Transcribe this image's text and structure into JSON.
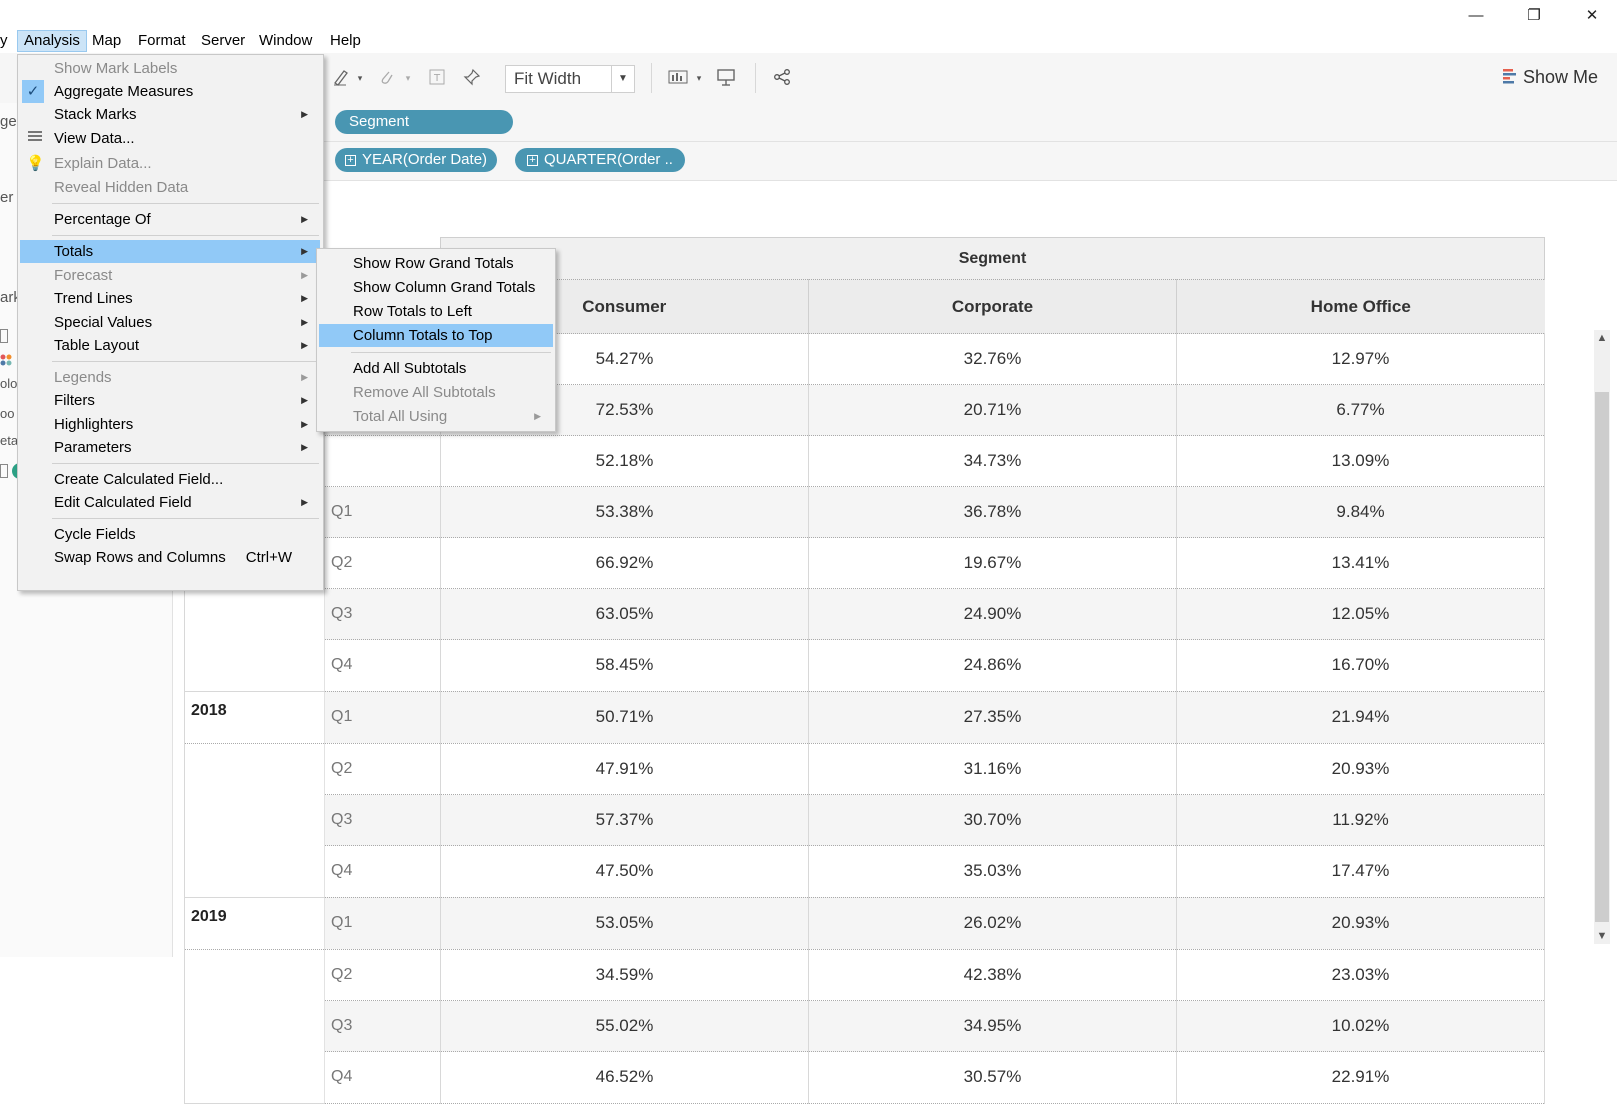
{
  "window": {
    "minimize": "—",
    "restore": "❐",
    "close": "✕"
  },
  "menubar": {
    "items": [
      {
        "label": "y"
      },
      {
        "label": "Analysis"
      },
      {
        "label": "Map"
      },
      {
        "label": "Format"
      },
      {
        "label": "Server"
      },
      {
        "label": "Window"
      },
      {
        "label": "Help"
      }
    ]
  },
  "toolbar": {
    "fit_label": "Fit Width",
    "show_me": "Show Me"
  },
  "shelves": {
    "columns_pill": "Segment",
    "rows_pills": [
      "YEAR(Order Date)",
      "QUARTER(Order .."
    ]
  },
  "leftpane": {
    "fragments": [
      "ge",
      "er",
      "ark",
      "A",
      "olo",
      "oo",
      "eta"
    ]
  },
  "analysis_menu": {
    "items": [
      {
        "label": "Show Mark Labels"
      },
      {
        "label": "Aggregate Measures"
      },
      {
        "label": "Stack Marks"
      },
      {
        "label": "View Data..."
      },
      {
        "label": "Explain Data..."
      },
      {
        "label": "Reveal Hidden Data"
      },
      {
        "label": "Percentage Of"
      },
      {
        "label": "Totals"
      },
      {
        "label": "Forecast"
      },
      {
        "label": "Trend Lines"
      },
      {
        "label": "Special Values"
      },
      {
        "label": "Table Layout"
      },
      {
        "label": "Legends"
      },
      {
        "label": "Filters"
      },
      {
        "label": "Highlighters"
      },
      {
        "label": "Parameters"
      },
      {
        "label": "Create Calculated Field..."
      },
      {
        "label": "Edit Calculated Field"
      },
      {
        "label": "Cycle Fields"
      },
      {
        "label": "Swap Rows and Columns",
        "shortcut": "Ctrl+W"
      }
    ]
  },
  "totals_submenu": {
    "items": [
      {
        "label": "Show Row Grand Totals"
      },
      {
        "label": "Show Column Grand Totals"
      },
      {
        "label": "Row Totals to Left"
      },
      {
        "label": "Column Totals to Top"
      },
      {
        "label": "Add All Subtotals"
      },
      {
        "label": "Remove All Subtotals"
      },
      {
        "label": "Total All Using"
      }
    ]
  },
  "table": {
    "segment_header": "Segment",
    "columns": [
      "Consumer",
      "Corporate",
      "Home Office"
    ],
    "rows": [
      {
        "year": "",
        "quarter": "",
        "values": [
          "54.27%",
          "32.76%",
          "12.97%"
        ]
      },
      {
        "year": "",
        "quarter": "",
        "values": [
          "72.53%",
          "20.71%",
          "6.77%"
        ]
      },
      {
        "year": "",
        "quarter": "",
        "values": [
          "52.18%",
          "34.73%",
          "13.09%"
        ]
      },
      {
        "year": "",
        "quarter": "Q1",
        "values": [
          "53.38%",
          "36.78%",
          "9.84%"
        ]
      },
      {
        "year": "",
        "quarter": "Q2",
        "values": [
          "66.92%",
          "19.67%",
          "13.41%"
        ]
      },
      {
        "year": "",
        "quarter": "Q3",
        "values": [
          "63.05%",
          "24.90%",
          "12.05%"
        ]
      },
      {
        "year": "",
        "quarter": "Q4",
        "values": [
          "58.45%",
          "24.86%",
          "16.70%"
        ]
      },
      {
        "year": "2018",
        "quarter": "Q1",
        "values": [
          "50.71%",
          "27.35%",
          "21.94%"
        ]
      },
      {
        "year": "",
        "quarter": "Q2",
        "values": [
          "47.91%",
          "31.16%",
          "20.93%"
        ]
      },
      {
        "year": "",
        "quarter": "Q3",
        "values": [
          "57.37%",
          "30.70%",
          "11.92%"
        ]
      },
      {
        "year": "",
        "quarter": "Q4",
        "values": [
          "47.50%",
          "35.03%",
          "17.47%"
        ]
      },
      {
        "year": "2019",
        "quarter": "Q1",
        "values": [
          "53.05%",
          "26.02%",
          "20.93%"
        ]
      },
      {
        "year": "",
        "quarter": "Q2",
        "values": [
          "34.59%",
          "42.38%",
          "23.03%"
        ]
      },
      {
        "year": "",
        "quarter": "Q3",
        "values": [
          "55.02%",
          "34.95%",
          "10.02%"
        ]
      },
      {
        "year": "",
        "quarter": "Q4",
        "values": [
          "46.52%",
          "30.57%",
          "22.91%"
        ]
      }
    ]
  },
  "colors": {
    "pill": "#4996b2",
    "menu_highlight": "#91c9f7",
    "submenu_highlight": "#91c9f7"
  }
}
